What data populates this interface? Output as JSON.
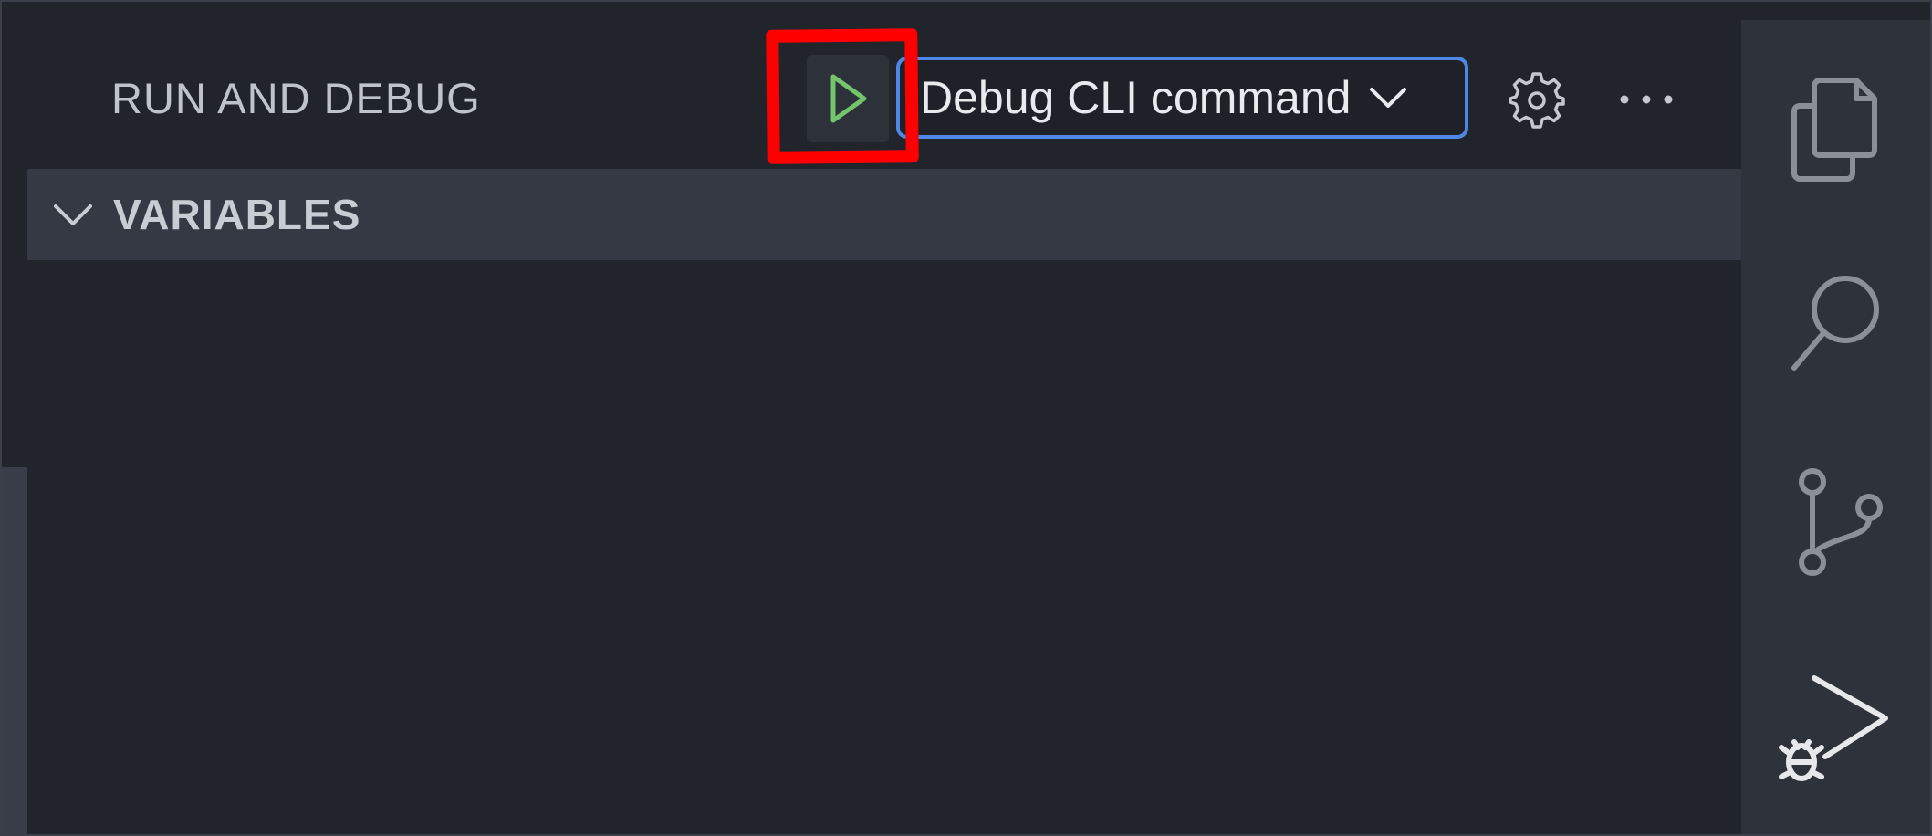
{
  "header": {
    "title": "RUN AND DEBUG",
    "run_button": {
      "icon": "play-icon",
      "color": "#73c46a"
    },
    "config_select": {
      "selected": "Debug CLI command",
      "icon": "chevron-down-icon"
    },
    "settings_icon": "gear-icon",
    "more_actions_icon": "ellipsis-icon"
  },
  "sections": [
    {
      "title": "VARIABLES",
      "icon": "chevron-down-icon",
      "expanded": true
    }
  ],
  "activity_bar": {
    "items": [
      {
        "name": "explorer",
        "icon": "files-icon"
      },
      {
        "name": "search",
        "icon": "search-icon"
      },
      {
        "name": "source-control",
        "icon": "source-control-icon"
      },
      {
        "name": "run-and-debug",
        "icon": "run-debug-icon",
        "active": true
      }
    ]
  },
  "colors": {
    "accent_border": "#4f87e6",
    "annotation": "#ff0000",
    "play_green": "#73c46a",
    "background": "#21252b",
    "section_header_bg": "#343944",
    "activity_bar_bg": "#2e323a"
  }
}
